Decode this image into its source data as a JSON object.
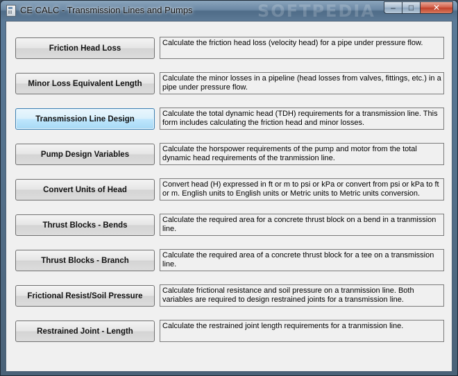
{
  "window": {
    "title": "CE CALC - Transmission Lines and Pumps",
    "watermark": "SOFTPEDIA",
    "controls": {
      "minimize": "–",
      "maximize": "□",
      "close": "✕"
    }
  },
  "rows": [
    {
      "button": "Friction Head Loss",
      "description": "Calculate the friction head loss (velocity head) for a pipe under pressure flow."
    },
    {
      "button": "Minor Loss Equivalent Length",
      "description": "Calculate the minor losses in a pipeline (head losses from valves, fittings, etc.) in a pipe under pressure flow."
    },
    {
      "button": "Transmission Line Design",
      "description": "Calculate the total dynamic head (TDH) requirements for a transmission line.  This form includes calculating the friction head and minor losses."
    },
    {
      "button": "Pump Design Variables",
      "description": "Calculate the horspower requirements of the pump and motor from the total dynamic head requirements of the tranmission line."
    },
    {
      "button": "Convert Units of Head",
      "description": "Convert head (H) expressed in ft or m  to psi or kPa or convert from psi or kPa to ft or m.  English units to English units or Metric units to Metric units conversion."
    },
    {
      "button": "Thrust Blocks - Bends",
      "description": "Calculate the required area for a concrete thrust block on a bend in a tranmission line."
    },
    {
      "button": "Thrust Blocks - Branch",
      "description": "Calculate the required area of a concrete thrust block for a tee on a transmission line."
    },
    {
      "button": "Frictional Resist/Soil Pressure",
      "description": "Calculate frictional resistance and soil pressure on a tranmission line.  Both variables are required to design restrained joints for a transmission line."
    },
    {
      "button": "Restrained Joint - Length",
      "description": "Calculate the restrained joint length requirements for a tranmission line."
    }
  ]
}
